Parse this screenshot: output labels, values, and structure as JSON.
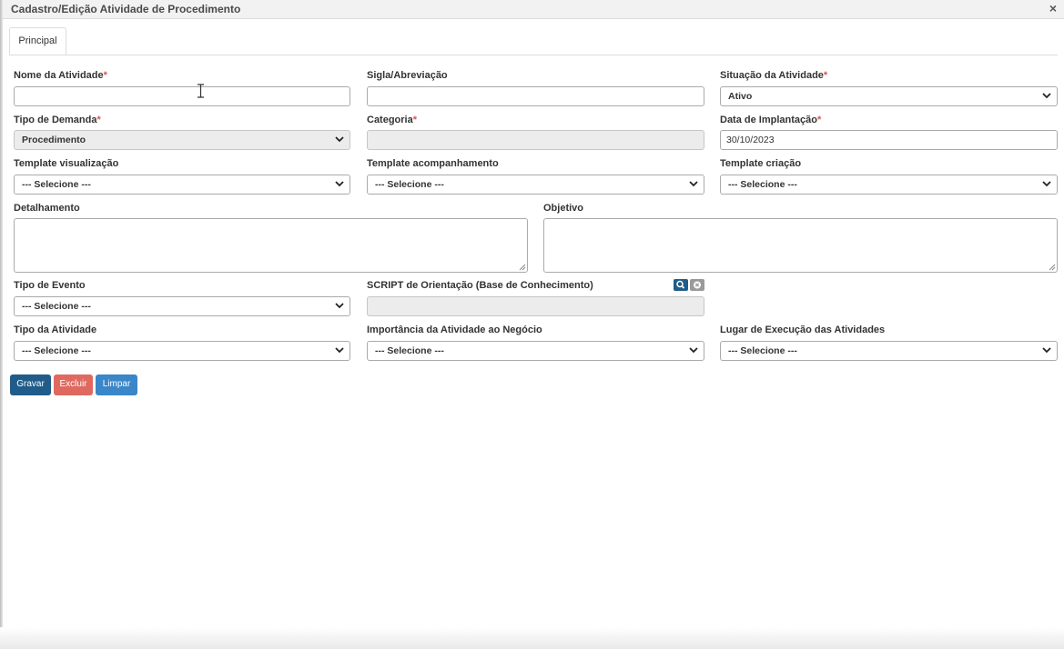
{
  "window": {
    "title": "Cadastro/Edição Atividade de Procedimento",
    "close_symbol": "×"
  },
  "tabs": [
    {
      "label": "Principal",
      "active": true
    }
  ],
  "required_marker": "*",
  "fields": {
    "nome_atividade": {
      "label": "Nome da Atividade",
      "required": true,
      "value": ""
    },
    "sigla": {
      "label": "Sigla/Abreviação",
      "required": false,
      "value": ""
    },
    "situacao": {
      "label": "Situação da Atividade",
      "required": true,
      "value": "Ativo"
    },
    "tipo_demanda": {
      "label": "Tipo de Demanda",
      "required": true,
      "value": "Procedimento",
      "disabled": true
    },
    "categoria": {
      "label": "Categoria",
      "required": true,
      "value": "",
      "disabled": true
    },
    "data_implantacao": {
      "label": "Data de Implantação",
      "required": true,
      "value": "30/10/2023"
    },
    "template_visualizacao": {
      "label": "Template visualização",
      "value": "--- Selecione ---"
    },
    "template_acompanhamento": {
      "label": "Template acompanhamento",
      "value": "--- Selecione ---"
    },
    "template_criacao": {
      "label": "Template criação",
      "value": "--- Selecione ---"
    },
    "detalhamento": {
      "label": "Detalhamento",
      "value": ""
    },
    "objetivo": {
      "label": "Objetivo",
      "value": ""
    },
    "tipo_evento": {
      "label": "Tipo de Evento",
      "value": "--- Selecione ---"
    },
    "script_orientacao": {
      "label": "SCRIPT de Orientação (Base de Conhecimento)",
      "value": "",
      "disabled": true
    },
    "tipo_atividade": {
      "label": "Tipo da Atividade",
      "value": "--- Selecione ---"
    },
    "importancia": {
      "label": "Importância da Atividade ao Negócio",
      "value": "--- Selecione ---"
    },
    "lugar_execucao": {
      "label": "Lugar de Execução das Atividades",
      "value": "--- Selecione ---"
    }
  },
  "buttons": {
    "gravar": {
      "label": "Gravar",
      "color": "#1f5c8a"
    },
    "excluir": {
      "label": "Excluir",
      "color": "#e0695f"
    },
    "limpar": {
      "label": "Limpar",
      "color": "#3a86c8"
    }
  },
  "colors": {
    "required": "#d9534f",
    "search_button": "#1f5c8a",
    "clear_button": "#9a9a9a"
  }
}
